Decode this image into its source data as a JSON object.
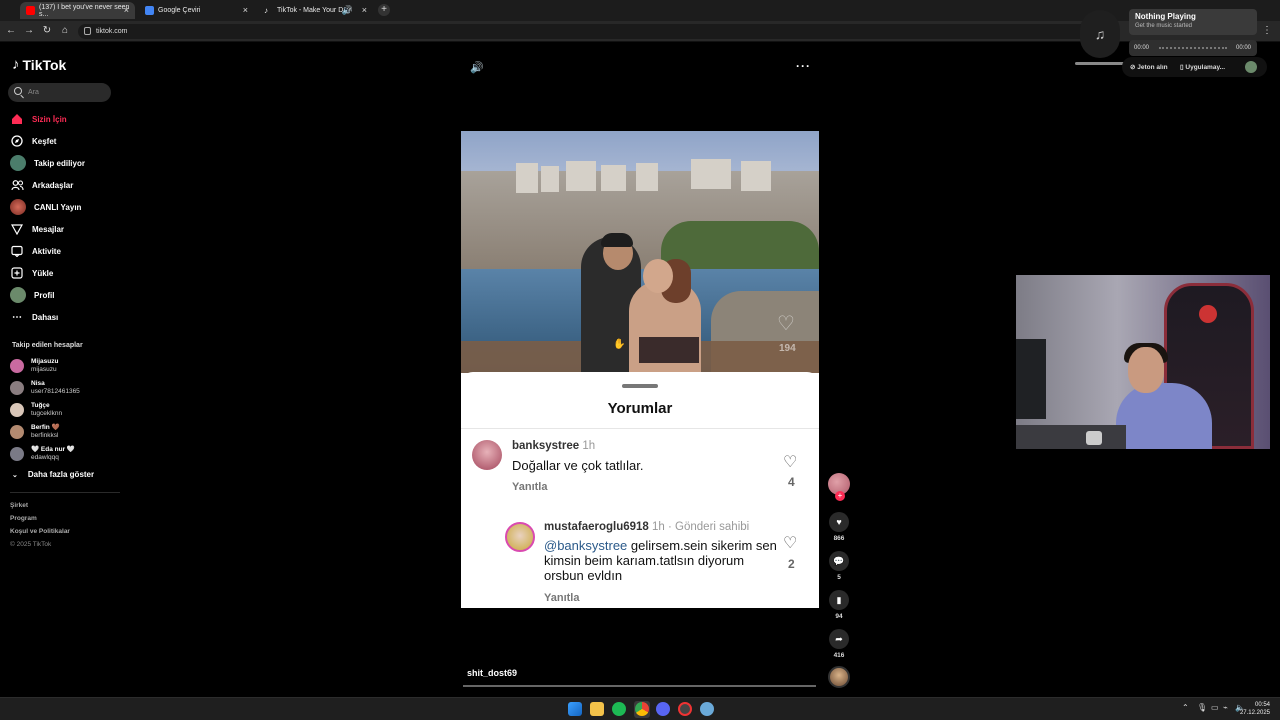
{
  "browser": {
    "tabs": [
      {
        "title": "(137) I bet you've never seen s...",
        "favicon_color": "#ff0000"
      },
      {
        "title": "Google Çeviri",
        "favicon_color": "#4285f4"
      },
      {
        "title": "TikTok - Make Your Day",
        "favicon_color": "#ffffff"
      }
    ],
    "url": "tiktok.com"
  },
  "tiktok": {
    "logo": "TikTok",
    "search_placeholder": "Ara",
    "nav": [
      {
        "label": "Sizin İçin",
        "icon": "home-icon",
        "active": true
      },
      {
        "label": "Keşfet",
        "icon": "compass-icon"
      },
      {
        "label": "Takip ediliyor",
        "icon": "following-icon"
      },
      {
        "label": "Arkadaşlar",
        "icon": "friends-icon"
      },
      {
        "label": "CANLI Yayın",
        "icon": "live-icon"
      },
      {
        "label": "Mesajlar",
        "icon": "messages-icon"
      },
      {
        "label": "Aktivite",
        "icon": "activity-icon"
      },
      {
        "label": "Yükle",
        "icon": "upload-icon"
      },
      {
        "label": "Profil",
        "icon": "profile-icon"
      },
      {
        "label": "Dahası",
        "icon": "more-icon"
      }
    ],
    "following_title": "Takip edilen hesaplar",
    "following": [
      {
        "name": "Mijasuzu",
        "handle": "mijasuzu"
      },
      {
        "name": "Nisa",
        "handle": "user7812461365"
      },
      {
        "name": "Tuğçe",
        "handle": "tugceklknn"
      },
      {
        "name": "Berfin 🤎",
        "handle": "berfinkksl"
      },
      {
        "name": "🤍 Eda nur 🤍",
        "handle": "edawlqqq"
      }
    ],
    "show_more": "Daha fazla göster",
    "footer": [
      "Şirket",
      "Program",
      "Koşul ve Politikalar",
      "© 2025 TikTok"
    ]
  },
  "video": {
    "overlay_likes": "194",
    "author": "shit_dost69",
    "comments_sheet": {
      "title": "Yorumlar",
      "comments": [
        {
          "user": "banksystree",
          "meta": "1h",
          "text": "Doğallar ve çok tatlılar.",
          "reply": "Yanıtla",
          "likes": "4"
        },
        {
          "user": "mustafaeroglu6918",
          "meta": "1h · Gönderi sahibi",
          "mention": "@banksystree",
          "text": " gelirsem.sein sikerim sen kimsin beim karıam.tatlsın diyorum orsbun evldın",
          "reply": "Yanıtla",
          "likes": "2"
        }
      ]
    },
    "actions": {
      "likes": "866",
      "comments": "5",
      "saves": "94",
      "shares": "416"
    }
  },
  "music_widget": {
    "title": "Nothing Playing",
    "subtitle": "Get the music started",
    "time_current": "00:00",
    "time_total": "00:00"
  },
  "tiktok_top": {
    "coins": "Jeton alın",
    "app": "Uygulamay..."
  },
  "taskbar": {
    "time": "00:54",
    "date": "27.12.2025"
  },
  "colors": {
    "accent": "#fe2c55",
    "background": "#000000"
  }
}
